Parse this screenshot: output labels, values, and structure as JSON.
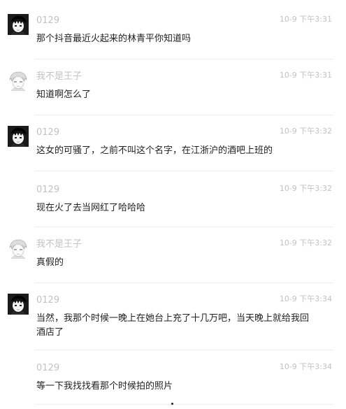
{
  "messages": [
    {
      "sender": "0129",
      "avatar": "dark-avatar-icon",
      "time": "10-9 下午3:31",
      "text": "那个抖音最近火起来的林青平你知道吗"
    },
    {
      "sender": "我不是王子",
      "avatar": "sketch-avatar-icon",
      "time": "10-9 下午3:31",
      "text": "知道啊怎么了"
    },
    {
      "sender": "0129",
      "avatar": "dark-avatar-icon",
      "time": "10-9 下午3:32",
      "text": "这女的可骚了，之前不叫这个名字，在江浙沪的酒吧上班的"
    },
    {
      "sender": "0129",
      "avatar": "none",
      "time": "10-9 下午3:32",
      "text": "现在火了去当网红了哈哈哈"
    },
    {
      "sender": "我不是王子",
      "avatar": "sketch-avatar-icon",
      "time": "10-9 下午3:32",
      "text": "真假的"
    },
    {
      "sender": "0129",
      "avatar": "dark-avatar-icon",
      "time": "10-9 下午3:34",
      "text": "当然，我那个时候一晚上在她台上充了十几万吧，当天晚上就给我回酒店了"
    },
    {
      "sender": "0129",
      "avatar": "none",
      "time": "10-9 下午3:34",
      "text": "等一下我找找看那个时候拍的照片"
    }
  ],
  "colors": {
    "meta_text": "#c2c2c2",
    "body_text": "#222222",
    "divider": "#eeeeee"
  }
}
